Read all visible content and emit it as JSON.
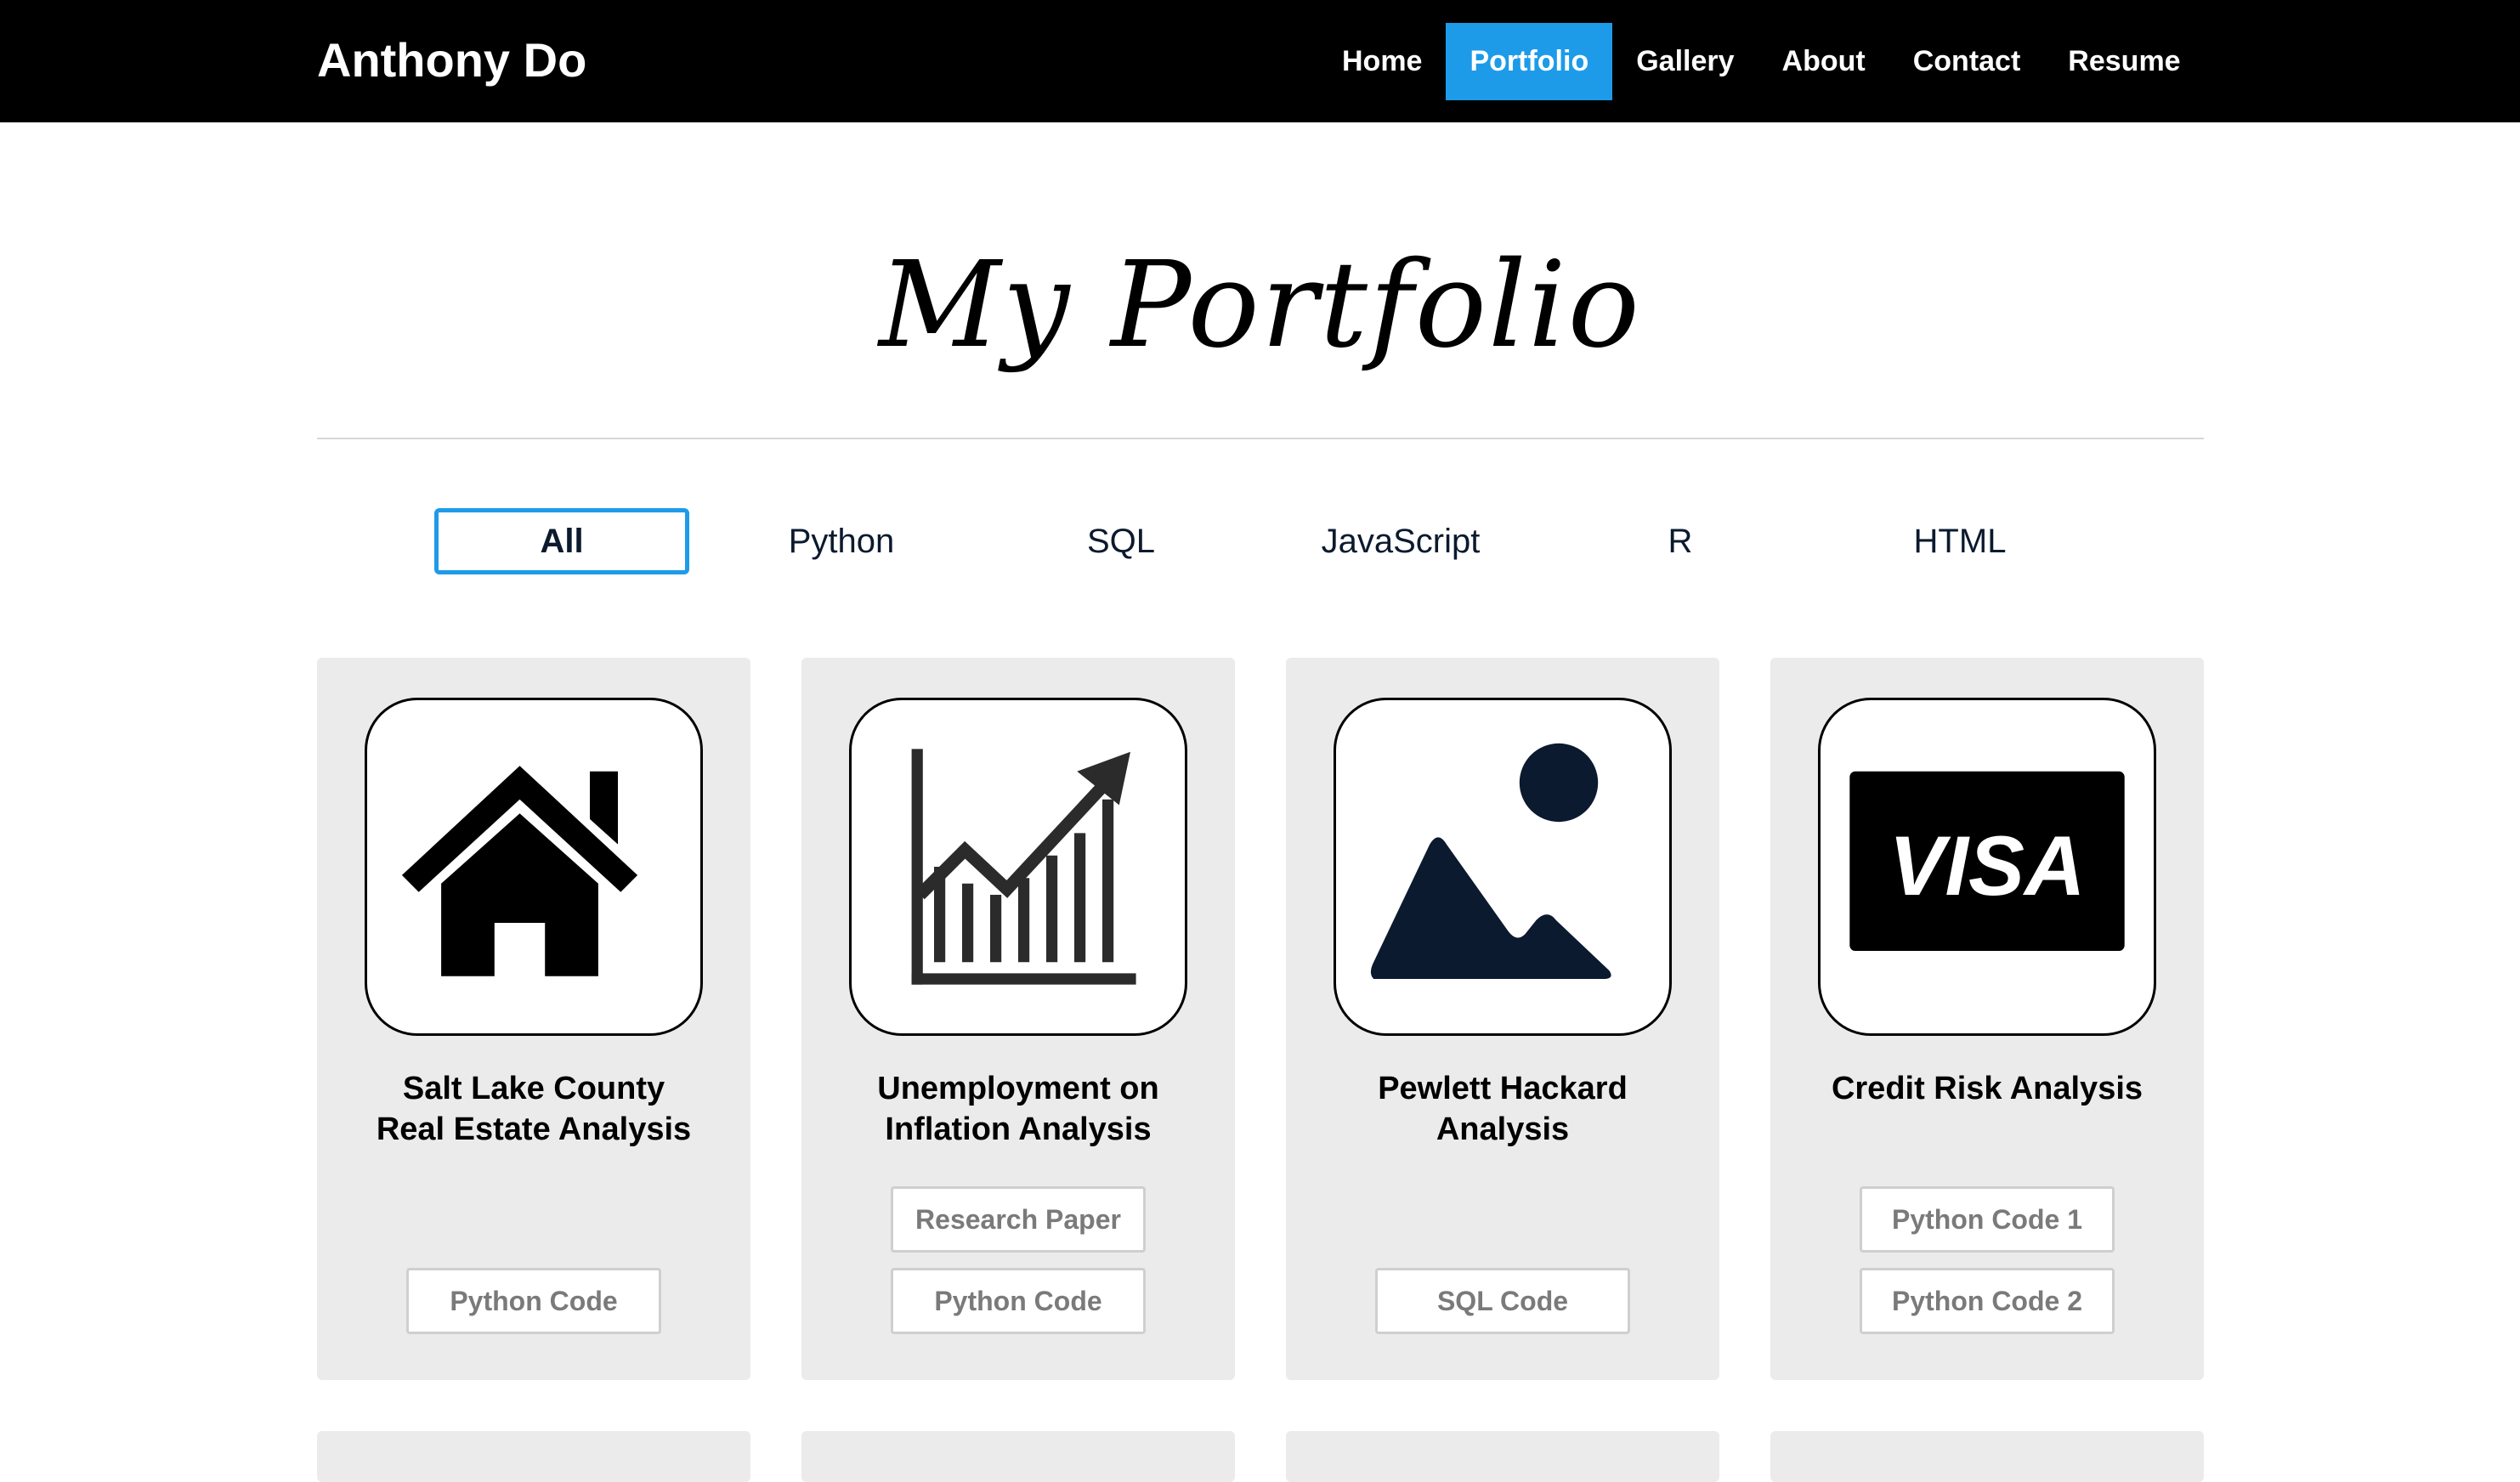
{
  "header": {
    "brand": "Anthony Do",
    "nav": [
      "Home",
      "Portfolio",
      "Gallery",
      "About",
      "Contact",
      "Resume"
    ],
    "active_nav": "Portfolio"
  },
  "page_title": "My Portfolio",
  "filters": [
    "All",
    "Python",
    "SQL",
    "JavaScript",
    "R",
    "HTML"
  ],
  "active_filter": "All",
  "projects": [
    {
      "icon": "house-icon",
      "title_lines": [
        "Salt Lake County",
        "Real Estate Analysis"
      ],
      "buttons": [
        "Python Code"
      ]
    },
    {
      "icon": "growth-chart-icon",
      "title_lines": [
        "Unemployment on",
        "Inflation Analysis"
      ],
      "buttons": [
        "Research Paper",
        "Python Code"
      ]
    },
    {
      "icon": "image-icon",
      "title_lines": [
        "Pewlett Hackard",
        "Analysis"
      ],
      "buttons": [
        "SQL Code"
      ]
    },
    {
      "icon": "visa-card-icon",
      "title_lines": [
        "Credit Risk Analysis"
      ],
      "visa_text": "VISA",
      "buttons": [
        "Python Code 1",
        "Python Code 2"
      ]
    }
  ],
  "colors": {
    "accent": "#1e9be8",
    "header_bg": "#000000",
    "card_bg": "#ebebeb",
    "button_text": "#7a7a7a",
    "image_icon_fill": "#0b1a2e"
  }
}
